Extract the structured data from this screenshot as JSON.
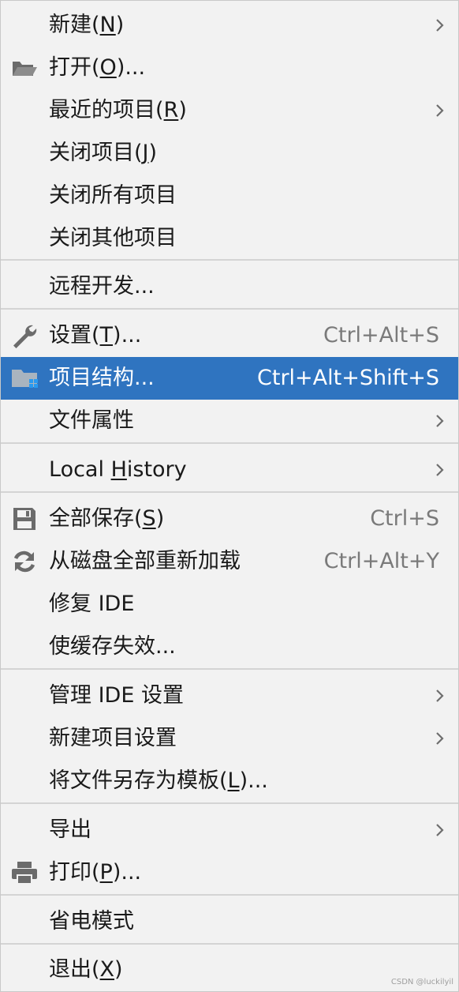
{
  "menu": {
    "new": {
      "label": "新建(",
      "mnemonic": "N",
      "suffix": ")"
    },
    "open": {
      "label": "打开(",
      "mnemonic": "O",
      "suffix": ")..."
    },
    "recent": {
      "label": "最近的项目(",
      "mnemonic": "R",
      "suffix": ")"
    },
    "close_project": {
      "label": "关闭项目(",
      "mnemonic": "J",
      "suffix": ")"
    },
    "close_all": {
      "label": "关闭所有项目"
    },
    "close_others": {
      "label": "关闭其他项目"
    },
    "remote_dev": {
      "label": "远程开发..."
    },
    "settings": {
      "label": "设置(",
      "mnemonic": "T",
      "suffix": ")...",
      "shortcut": "Ctrl+Alt+S"
    },
    "project_structure": {
      "label": "项目结构...",
      "shortcut": "Ctrl+Alt+Shift+S"
    },
    "file_properties": {
      "label": "文件属性"
    },
    "local_history": {
      "prefix": "Local ",
      "mnemonic": "H",
      "suffix": "istory"
    },
    "save_all": {
      "label": "全部保存(",
      "mnemonic": "S",
      "suffix": ")",
      "shortcut": "Ctrl+S"
    },
    "reload": {
      "label": "从磁盘全部重新加载",
      "shortcut": "Ctrl+Alt+Y"
    },
    "repair_ide": {
      "label": "修复 IDE"
    },
    "invalidate_caches": {
      "label": "使缓存失效..."
    },
    "manage_ide_settings": {
      "label": "管理 IDE 设置"
    },
    "new_project_settings": {
      "label": "新建项目设置"
    },
    "save_as_template": {
      "label": "将文件另存为模板(",
      "mnemonic": "L",
      "suffix": ")..."
    },
    "export": {
      "label": "导出"
    },
    "print": {
      "label": "打印(",
      "mnemonic": "P",
      "suffix": ")..."
    },
    "power_save": {
      "label": "省电模式"
    },
    "exit": {
      "label": "退出(",
      "mnemonic": "X",
      "suffix": ")"
    }
  },
  "icons": {
    "open": "folder-open-icon",
    "settings": "wrench-icon",
    "project_structure": "project-structure-icon",
    "save_all": "save-icon",
    "reload": "reload-icon",
    "print": "printer-icon",
    "submenu": "chevron-right-icon"
  },
  "colors": {
    "selection": "#2f74c0",
    "background": "#f2f2f2",
    "shortcut_text": "#7a7a7a"
  },
  "watermark": "CSDN @luckilyil"
}
